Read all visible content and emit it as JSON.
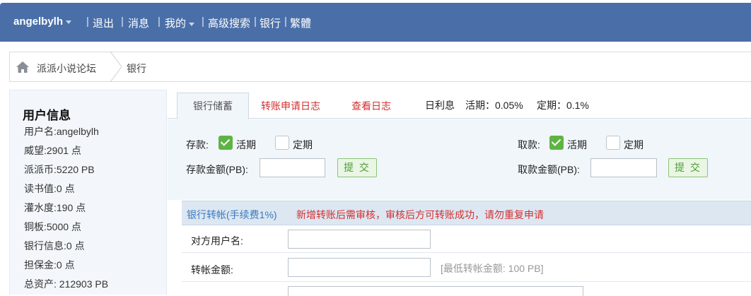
{
  "topbar": {
    "username": "angelbylh",
    "logout": "退出",
    "messages": "消息",
    "mine": "我的",
    "advanced_search": "高级搜索",
    "bank": "银行",
    "traditional": "繁體"
  },
  "breadcrumb": {
    "forum": "派派小说论坛",
    "current": "银行"
  },
  "user_info": {
    "title": "用户信息",
    "rows": [
      "用户名:angelbylh",
      "威望:2901 点",
      "派派币:5220 PB",
      "读书值:0 点",
      "灌水度:190 点",
      "铜板:5000 点",
      "银行信息:0 点",
      "担保金:0 点",
      "总资产: 212903 PB"
    ]
  },
  "tabs": {
    "savings": "银行储蓄",
    "transfer_log": "转账申请日志",
    "view_log": "查看日志"
  },
  "rates": {
    "label": "日利息",
    "current": "活期：0.05%",
    "fixed": "定期：0.1%"
  },
  "deposit": {
    "label": "存款:",
    "current_label": "活期",
    "current_checked": true,
    "fixed_label": "定期",
    "fixed_checked": false,
    "amount_label": "存款金额(PB):",
    "submit": "提 交"
  },
  "withdraw": {
    "label": "取款:",
    "current_label": "活期",
    "current_checked": true,
    "fixed_label": "定期",
    "fixed_checked": false,
    "amount_label": "取款金额(PB):",
    "submit": "提 交"
  },
  "transfer": {
    "title": "银行转帐(手续费1%)",
    "notice": "新增转账后需审核，审核后方可转账成功，请勿重复申请",
    "recipient_label": "对方用户名:",
    "amount_label": "转帐金额:",
    "amount_hint": "[最低转帐金额: 100 PB]"
  },
  "colors": {
    "topbar": "#4a6fa8",
    "accent_red": "#d42f2f",
    "accent_blue": "#3a79c0",
    "check_green": "#5eb443"
  }
}
